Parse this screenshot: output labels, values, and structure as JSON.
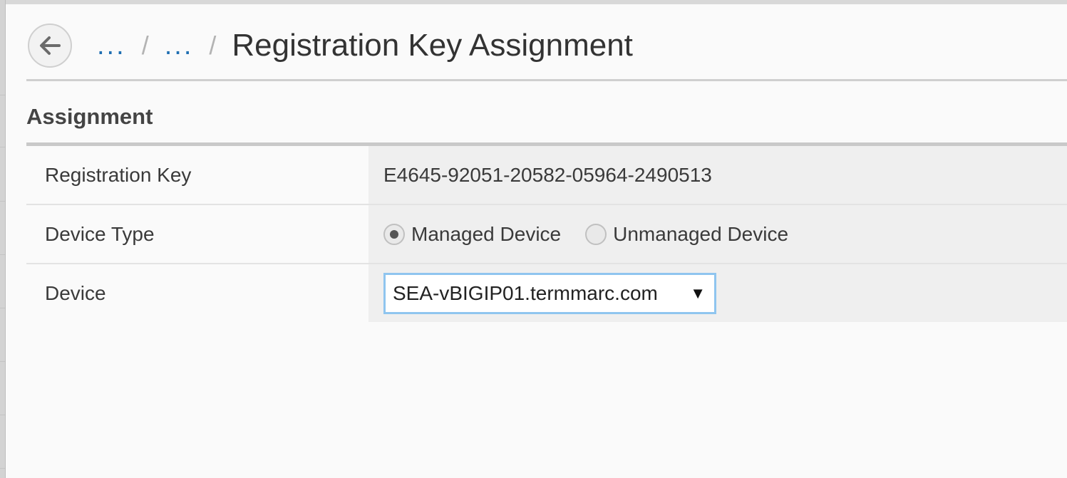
{
  "breadcrumb": {
    "items": [
      "...",
      "..."
    ],
    "separator": "/",
    "current": "Registration Key Assignment"
  },
  "section": {
    "title": "Assignment"
  },
  "form": {
    "registration_key": {
      "label": "Registration Key",
      "value": "E4645-92051-20582-05964-2490513"
    },
    "device_type": {
      "label": "Device Type",
      "options": [
        {
          "label": "Managed Device",
          "selected": true
        },
        {
          "label": "Unmanaged Device",
          "selected": false
        }
      ]
    },
    "device": {
      "label": "Device",
      "selected": "SEA-vBIGIP01.termmarc.com",
      "arrow": "▼"
    }
  },
  "icons": {
    "back": "arrow-left-icon",
    "dropdown": "caret-down-icon"
  },
  "colors": {
    "link": "#1f6fb2",
    "focus_border": "#8fc5ef",
    "value_cell_bg": "#efefef"
  }
}
